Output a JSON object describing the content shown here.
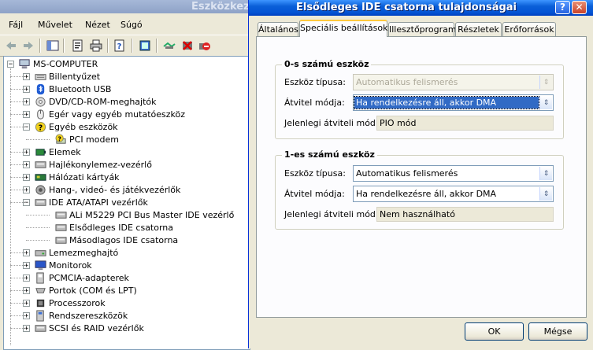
{
  "background_window": {
    "title": "Eszközkezel",
    "menu": [
      "Fájl",
      "Művelet",
      "Nézet",
      "Súgó"
    ],
    "tree": [
      {
        "label": "MS-COMPUTER",
        "level": 0,
        "expander": "−",
        "icon": "computer-icon"
      },
      {
        "label": "Billentyűzet",
        "level": 1,
        "expander": "+",
        "icon": "keyboard-icon"
      },
      {
        "label": "Bluetooth USB",
        "level": 1,
        "expander": "+",
        "icon": "bluetooth-icon"
      },
      {
        "label": "DVD/CD-ROM-meghajtók",
        "level": 1,
        "expander": "+",
        "icon": "cd-drive-icon"
      },
      {
        "label": "Egér vagy egyéb mutatóeszköz",
        "level": 1,
        "expander": "+",
        "icon": "mouse-icon"
      },
      {
        "label": "Egyéb eszközök",
        "level": 1,
        "expander": "−",
        "icon": "unknown-device-icon"
      },
      {
        "label": "PCI modem",
        "level": 2,
        "expander": "",
        "icon": "warning-device-icon"
      },
      {
        "label": "Elemek",
        "level": 1,
        "expander": "+",
        "icon": "battery-icon"
      },
      {
        "label": "Hajlékonylemez-vezérlő",
        "level": 1,
        "expander": "+",
        "icon": "controller-icon"
      },
      {
        "label": "Hálózati kártyák",
        "level": 1,
        "expander": "+",
        "icon": "network-card-icon"
      },
      {
        "label": "Hang-, videó- és játékvezérlők",
        "level": 1,
        "expander": "+",
        "icon": "speaker-icon"
      },
      {
        "label": "IDE ATA/ATAPI vezérlők",
        "level": 1,
        "expander": "−",
        "icon": "controller-icon"
      },
      {
        "label": "ALi M5229 PCI Bus Master IDE vezérlő",
        "level": 2,
        "expander": "",
        "icon": "controller-icon"
      },
      {
        "label": "Elsődleges IDE csatorna",
        "level": 2,
        "expander": "",
        "icon": "controller-icon"
      },
      {
        "label": "Másodlagos IDE csatorna",
        "level": 2,
        "expander": "",
        "icon": "controller-icon"
      },
      {
        "label": "Lemezmeghajtó",
        "level": 1,
        "expander": "+",
        "icon": "disk-icon"
      },
      {
        "label": "Monitorok",
        "level": 1,
        "expander": "+",
        "icon": "monitor-icon"
      },
      {
        "label": "PCMCIA-adapterek",
        "level": 1,
        "expander": "+",
        "icon": "pcmcia-icon"
      },
      {
        "label": "Portok (COM és LPT)",
        "level": 1,
        "expander": "+",
        "icon": "port-icon"
      },
      {
        "label": "Processzorok",
        "level": 1,
        "expander": "+",
        "icon": "processor-icon"
      },
      {
        "label": "Rendszereszközök",
        "level": 1,
        "expander": "+",
        "icon": "system-device-icon"
      },
      {
        "label": "SCSI és RAID vezérlők",
        "level": 1,
        "expander": "+",
        "icon": "controller-icon"
      }
    ]
  },
  "dialog": {
    "title": "Elsődleges IDE csatorna tulajdonságai",
    "tabs": [
      "Általános",
      "Speciális beállítások",
      "Illesztőprogram",
      "Részletek",
      "Erőforrások"
    ],
    "active_tab": "Speciális beállítások",
    "device0": {
      "title": "0-s számú eszköz",
      "type_label": "Eszköz típusa:",
      "type_value": "Automatikus felismerés",
      "mode_label": "Átvitel módja:",
      "mode_value": "Ha rendelkezésre áll, akkor DMA",
      "current_label": "Jelenlegi átviteli mód:",
      "current_value": "PIO mód"
    },
    "device1": {
      "title": "1-es számú eszköz",
      "type_label": "Eszköz típusa:",
      "type_value": "Automatikus felismerés",
      "mode_label": "Átvitel módja:",
      "mode_value": "Ha rendelkezésre áll, akkor DMA",
      "current_label": "Jelenlegi átviteli mód:",
      "current_value": "Nem használható"
    },
    "ok_label": "OK",
    "cancel_label": "Mégse",
    "help_glyph": "?",
    "close_glyph": "✕"
  },
  "colors": {
    "dialog_titlebar": "#0454d4",
    "inactive_titlebar": "#8ea2c7",
    "selection": "#316ac5",
    "window_bg": "#ece9d8"
  }
}
